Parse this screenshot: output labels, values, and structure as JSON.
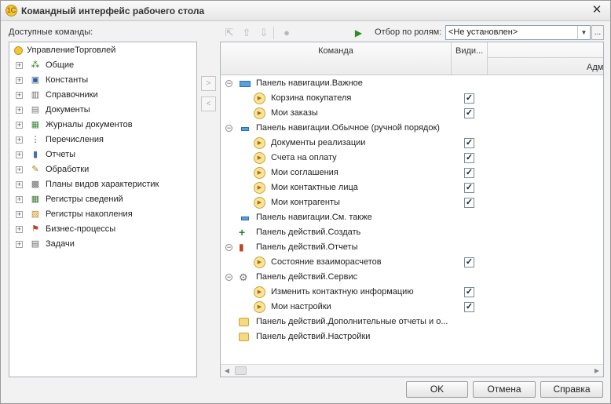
{
  "window": {
    "title": "Командный интерфейс рабочего стола"
  },
  "left": {
    "label": "Доступные команды:",
    "root": "УправлениеТорговлей",
    "items": [
      {
        "label": "Общие",
        "icon": "common-icon"
      },
      {
        "label": "Константы",
        "icon": "constants-icon"
      },
      {
        "label": "Справочники",
        "icon": "catalogs-icon"
      },
      {
        "label": "Документы",
        "icon": "documents-icon"
      },
      {
        "label": "Журналы документов",
        "icon": "journals-icon"
      },
      {
        "label": "Перечисления",
        "icon": "enums-icon"
      },
      {
        "label": "Отчеты",
        "icon": "reports-icon"
      },
      {
        "label": "Обработки",
        "icon": "processing-icon"
      },
      {
        "label": "Планы видов характеристик",
        "icon": "char-types-icon"
      },
      {
        "label": "Регистры сведений",
        "icon": "info-registers-icon"
      },
      {
        "label": "Регистры накопления",
        "icon": "accum-registers-icon"
      },
      {
        "label": "Бизнес-процессы",
        "icon": "business-process-icon"
      },
      {
        "label": "Задачи",
        "icon": "tasks-icon"
      }
    ]
  },
  "toolbar": {
    "filter_label": "Отбор по ролям:",
    "filter_value": "<Не установлен>",
    "more": "..."
  },
  "grid": {
    "col_command": "Команда",
    "col_visible": "Види...",
    "col_admin": "Адм",
    "rows": [
      {
        "type": "group",
        "label": "Панель навигации.Важное",
        "icon": "nav-panel-icon",
        "expanded": true
      },
      {
        "type": "cmd",
        "label": "Корзина покупателя",
        "checked": true
      },
      {
        "type": "cmd",
        "label": "Мои заказы",
        "checked": true
      },
      {
        "type": "group",
        "label": "Панель навигации.Обычное (ручной порядок)",
        "icon": "nav-panel-small-icon",
        "expanded": true
      },
      {
        "type": "cmd",
        "label": "Документы реализации",
        "checked": true
      },
      {
        "type": "cmd",
        "label": "Счета на оплату",
        "checked": true
      },
      {
        "type": "cmd",
        "label": "Мои соглашения",
        "checked": true
      },
      {
        "type": "cmd",
        "label": "Мои контактные лица",
        "checked": true
      },
      {
        "type": "cmd",
        "label": "Мои контрагенты",
        "checked": true
      },
      {
        "type": "leafgroup",
        "label": "Панель навигации.См. также",
        "icon": "nav-panel-small-icon"
      },
      {
        "type": "leafgroup",
        "label": "Панель действий.Создать",
        "icon": "create-icon"
      },
      {
        "type": "group",
        "label": "Панель действий.Отчеты",
        "icon": "reports-icon",
        "expanded": true
      },
      {
        "type": "cmd",
        "label": "Состояние взаиморасчетов",
        "checked": true
      },
      {
        "type": "group",
        "label": "Панель действий.Сервис",
        "icon": "service-gear-icon",
        "expanded": true
      },
      {
        "type": "cmd",
        "label": "Изменить контактную информацию",
        "checked": true
      },
      {
        "type": "cmd",
        "label": "Мои настройки",
        "checked": true
      },
      {
        "type": "leafgroup",
        "label": "Панель действий.Дополнительные отчеты и о...",
        "icon": "folder-icon"
      },
      {
        "type": "leafgroup",
        "label": "Панель действий.Настройки",
        "icon": "folder-icon"
      }
    ]
  },
  "buttons": {
    "ok": "OK",
    "cancel": "Отмена",
    "help": "Справка"
  }
}
